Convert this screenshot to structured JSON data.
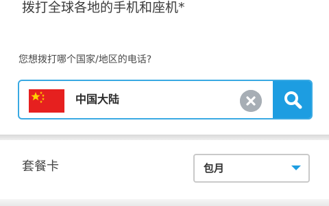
{
  "header": {
    "title": "拨打全球各地的手机和座机*"
  },
  "form": {
    "question": "您想拨打哪个国家/地区的电话?",
    "selected_country": "中国大陆",
    "flag_icon": "china-flag-icon",
    "clear_icon": "clear-icon",
    "search_icon": "search-icon",
    "accent_color": "#1d9de1"
  },
  "plan": {
    "label": "套餐卡",
    "selected": "包月",
    "dropdown_icon": "chevron-down-icon"
  }
}
